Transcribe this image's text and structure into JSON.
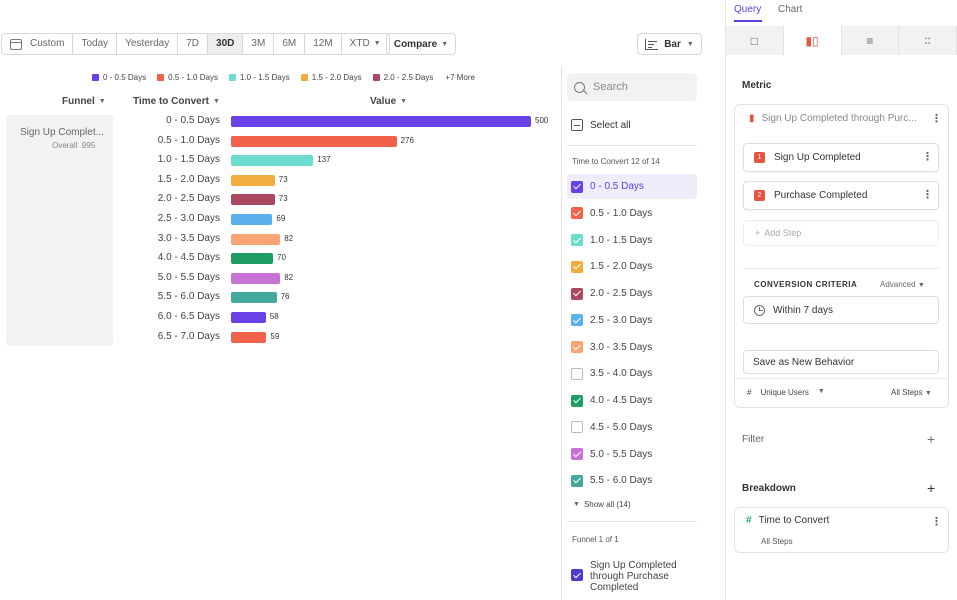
{
  "toolbar": {
    "date_buttons": [
      {
        "label": "Custom",
        "active": false
      },
      {
        "label": "Today",
        "active": false
      },
      {
        "label": "Yesterday",
        "active": false
      },
      {
        "label": "7D",
        "active": false
      },
      {
        "label": "30D",
        "active": true
      },
      {
        "label": "3M",
        "active": false
      },
      {
        "label": "6M",
        "active": false
      },
      {
        "label": "12M",
        "active": false
      },
      {
        "label": "XTD",
        "active": false
      }
    ],
    "compare_label": "Compare",
    "chart_type_label": "Bar"
  },
  "legend": {
    "items": [
      {
        "label": "0 - 0.5 Days",
        "color": "#6842e8"
      },
      {
        "label": "0.5 - 1.0 Days",
        "color": "#f2624b"
      },
      {
        "label": "1.0 - 1.5 Days",
        "color": "#6bdccd"
      },
      {
        "label": "1.5 - 2.0 Days",
        "color": "#f1ad3e"
      },
      {
        "label": "2.0 - 2.5 Days",
        "color": "#a9485f"
      }
    ],
    "more_label": "+7 More"
  },
  "columns": {
    "funnel": "Funnel",
    "time_to_convert": "Time to Convert",
    "value": "Value"
  },
  "funnel_cell": {
    "name": "Sign Up Complet...",
    "sub_label": "Overall",
    "sub_value": "995"
  },
  "chart_data": {
    "type": "bar",
    "orientation": "horizontal",
    "categories": [
      "0 - 0.5 Days",
      "0.5 - 1.0 Days",
      "1.0 - 1.5 Days",
      "1.5 - 2.0 Days",
      "2.0 - 2.5 Days",
      "2.5 - 3.0 Days",
      "3.0 - 3.5 Days",
      "4.0 - 4.5 Days",
      "5.0 - 5.5 Days",
      "5.5 - 6.0 Days",
      "6.0 - 6.5 Days",
      "6.5 - 7.0 Days"
    ],
    "values": [
      500,
      276,
      137,
      73,
      73,
      69,
      82,
      70,
      82,
      76,
      58,
      59
    ],
    "colors": [
      "#6842e8",
      "#f2624b",
      "#6bdccd",
      "#f1ad3e",
      "#a9485f",
      "#5bb1ec",
      "#f8a477",
      "#1e9d62",
      "#c872d6",
      "#43a99d",
      "#6842e8",
      "#f2624b"
    ],
    "xmax": 500
  },
  "filter_panel": {
    "search_placeholder": "Search",
    "select_all_label": "Select all",
    "section_label": "Time to Convert 12 of 14",
    "items": [
      {
        "label": "0 - 0.5 Days",
        "checked": true,
        "color": "#6842e8",
        "highlight": true
      },
      {
        "label": "0.5 - 1.0 Days",
        "checked": true,
        "color": "#f2624b",
        "highlight": false
      },
      {
        "label": "1.0 - 1.5 Days",
        "checked": true,
        "color": "#6bdccd",
        "highlight": false
      },
      {
        "label": "1.5 - 2.0 Days",
        "checked": true,
        "color": "#f1ad3e",
        "highlight": false
      },
      {
        "label": "2.0 - 2.5 Days",
        "checked": true,
        "color": "#a9485f",
        "highlight": false
      },
      {
        "label": "2.5 - 3.0 Days",
        "checked": true,
        "color": "#5bb1ec",
        "highlight": false
      },
      {
        "label": "3.0 - 3.5 Days",
        "checked": true,
        "color": "#f8a477",
        "highlight": false
      },
      {
        "label": "3.5 - 4.0 Days",
        "checked": false,
        "color": "#bbbbbb",
        "highlight": false
      },
      {
        "label": "4.0 - 4.5 Days",
        "checked": true,
        "color": "#1e9d62",
        "highlight": false
      },
      {
        "label": "4.5 - 5.0 Days",
        "checked": false,
        "color": "#bbbbbb",
        "highlight": false
      },
      {
        "label": "5.0 - 5.5 Days",
        "checked": true,
        "color": "#c872d6",
        "highlight": false
      },
      {
        "label": "5.5 - 6.0 Days",
        "checked": true,
        "color": "#43a99d",
        "highlight": false
      }
    ],
    "show_all_label": "Show all (14)",
    "funnel_section_label": "Funnel 1 of 1",
    "funnel_item": [
      "Sign Up Completed",
      "through Purchase",
      "Completed"
    ]
  },
  "right_panel": {
    "tabs": [
      "Query",
      "Chart"
    ],
    "metric_title": "Metric",
    "metric_name": "Sign Up Completed through Purc...",
    "steps": [
      {
        "num": "1",
        "label": "Sign Up Completed"
      },
      {
        "num": "2",
        "label": "Purchase Completed"
      }
    ],
    "add_step_label": "Add Step",
    "criteria_title": "CONVERSION CRITERIA",
    "criteria_advanced": "Advanced",
    "within_label": "Within 7 days",
    "save_label": "Save as New Behavior",
    "count_label": "Unique Users",
    "steps_scope": "All Steps",
    "filter_title": "Filter",
    "breakdown_title": "Breakdown",
    "breakdown_property": "Time to Convert",
    "breakdown_scope": "All Steps"
  }
}
